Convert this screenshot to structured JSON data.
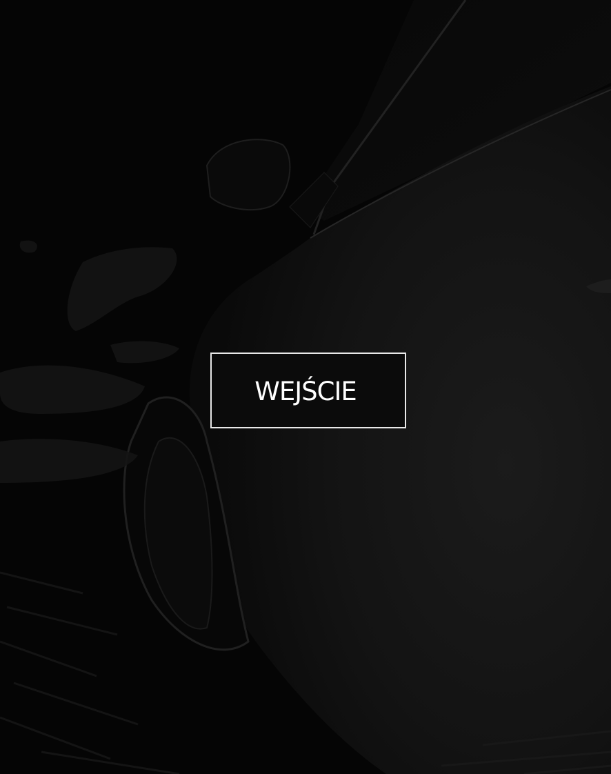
{
  "splash": {
    "background_image": "dark-car-side-view",
    "enter_label": "WEJŚCIE",
    "colors": {
      "background": "#060606",
      "button_border": "#e9e9e9",
      "button_fill": "#0b0b0b",
      "label": "#ffffff"
    }
  }
}
